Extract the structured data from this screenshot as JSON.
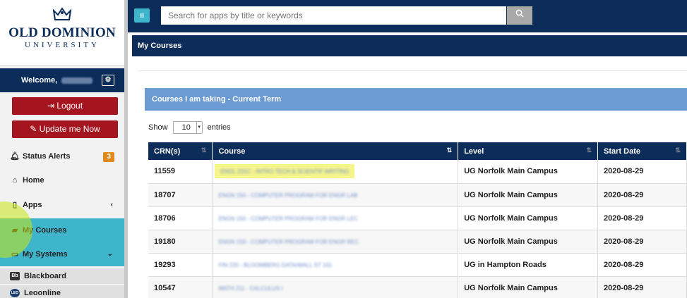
{
  "logo": {
    "main": "OLD DOMINION",
    "sub": "UNIVERSITY"
  },
  "welcome": {
    "label": "Welcome,",
    "name": "Cameron"
  },
  "buttons": {
    "logout": "Logout",
    "update": "Update me Now"
  },
  "nav": [
    {
      "label": "Status Alerts",
      "icon": "bell-icon",
      "badge": "3"
    },
    {
      "label": "Home",
      "icon": "home-icon"
    },
    {
      "label": "Apps",
      "icon": "mobile-icon",
      "chevron": "‹"
    },
    {
      "label": "My Courses",
      "icon": "book-icon"
    },
    {
      "label": "My Systems",
      "icon": "desktop-icon",
      "chevron": "⌄"
    }
  ],
  "subnav": [
    {
      "label": "Blackboard",
      "icon": "Bb"
    },
    {
      "label": "Leoonline",
      "icon": "LEO"
    }
  ],
  "search": {
    "placeholder": "Search for apps by title or keywords"
  },
  "page": {
    "title": "My Courses"
  },
  "panel": {
    "title": "Courses I am taking - Current Term"
  },
  "table_controls": {
    "show": "Show",
    "entries_value": "10",
    "entries": "entries"
  },
  "table": {
    "headers": [
      "CRN(s)",
      "Course",
      "Level",
      "Start Date"
    ],
    "rows": [
      {
        "crn": "11559",
        "course": "ENGL 231C - INTRO TECH & SCIENTIF WRITING",
        "level": "UG Norfolk Main Campus",
        "start": "2020-08-29"
      },
      {
        "crn": "18707",
        "course": "ENGN 150 - COMPUTER PROGRAM FOR ENGR LAB",
        "level": "UG Norfolk Main Campus",
        "start": "2020-08-29"
      },
      {
        "crn": "18706",
        "course": "ENGN 150 - COMPUTER PROGRAM FOR ENGR LEC",
        "level": "UG Norfolk Main Campus",
        "start": "2020-08-29"
      },
      {
        "crn": "19180",
        "course": "ENGN 150 - COMPUTER PROGRAM FOR ENGR REC",
        "level": "UG Norfolk Main Campus",
        "start": "2020-08-29"
      },
      {
        "crn": "19293",
        "course": "FIN 220 - BLOOMBERG DATA/WALL ST 101",
        "level": "UG in Hampton Roads",
        "start": "2020-08-29"
      },
      {
        "crn": "10547",
        "course": "MATH 211 - CALCULUS I",
        "level": "UG Norfolk Main Campus",
        "start": "2020-08-29"
      }
    ]
  },
  "colors": {
    "navy": "#0c2d5a",
    "teal": "#3fb5cc",
    "red": "#a5151f",
    "panel_blue": "#6b9bd2",
    "highlight": "#f6f58c"
  }
}
